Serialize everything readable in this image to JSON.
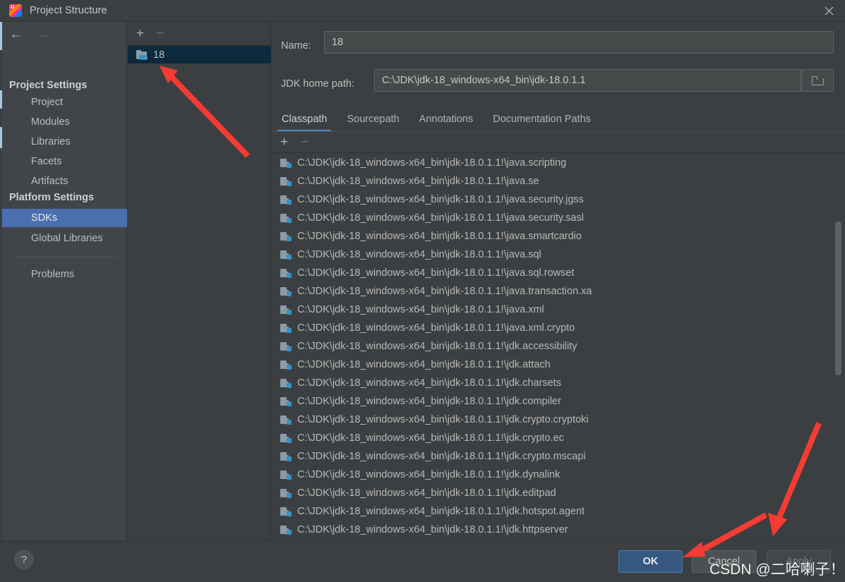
{
  "window": {
    "title": "Project Structure",
    "app_icon": "intellij-idea-icon",
    "close_icon": "close-icon"
  },
  "sidebar": {
    "back_icon": "arrow-left-icon",
    "forward_icon": "arrow-right-icon",
    "groups": [
      {
        "title": "Project Settings",
        "items": [
          "Project",
          "Modules",
          "Libraries",
          "Facets",
          "Artifacts"
        ]
      },
      {
        "title": "Platform Settings",
        "items": [
          "SDKs",
          "Global Libraries"
        ]
      }
    ],
    "selected_item": "SDKs",
    "extra_items": [
      "Problems"
    ]
  },
  "sdk_panel": {
    "add_label": "+",
    "remove_label": "−",
    "items": [
      {
        "label": "18",
        "icon": "folder-java-icon",
        "selected": true
      }
    ]
  },
  "detail": {
    "name_label": "Name:",
    "name_value": "18",
    "jdk_path_label": "JDK home path:",
    "jdk_path_value": "C:\\JDK\\jdk-18_windows-x64_bin\\jdk-18.0.1.1",
    "browse_icon": "folder-open-icon",
    "tabs": [
      {
        "label": "Classpath",
        "active": true
      },
      {
        "label": "Sourcepath",
        "active": false
      },
      {
        "label": "Annotations",
        "active": false
      },
      {
        "label": "Documentation Paths",
        "active": false
      }
    ],
    "classpath_toolbar": {
      "add_label": "+",
      "remove_label": "−",
      "remove_disabled": true
    },
    "classpath_entries": [
      "C:\\JDK\\jdk-18_windows-x64_bin\\jdk-18.0.1.1!\\java.scripting",
      "C:\\JDK\\jdk-18_windows-x64_bin\\jdk-18.0.1.1!\\java.se",
      "C:\\JDK\\jdk-18_windows-x64_bin\\jdk-18.0.1.1!\\java.security.jgss",
      "C:\\JDK\\jdk-18_windows-x64_bin\\jdk-18.0.1.1!\\java.security.sasl",
      "C:\\JDK\\jdk-18_windows-x64_bin\\jdk-18.0.1.1!\\java.smartcardio",
      "C:\\JDK\\jdk-18_windows-x64_bin\\jdk-18.0.1.1!\\java.sql",
      "C:\\JDK\\jdk-18_windows-x64_bin\\jdk-18.0.1.1!\\java.sql.rowset",
      "C:\\JDK\\jdk-18_windows-x64_bin\\jdk-18.0.1.1!\\java.transaction.xa",
      "C:\\JDK\\jdk-18_windows-x64_bin\\jdk-18.0.1.1!\\java.xml",
      "C:\\JDK\\jdk-18_windows-x64_bin\\jdk-18.0.1.1!\\java.xml.crypto",
      "C:\\JDK\\jdk-18_windows-x64_bin\\jdk-18.0.1.1!\\jdk.accessibility",
      "C:\\JDK\\jdk-18_windows-x64_bin\\jdk-18.0.1.1!\\jdk.attach",
      "C:\\JDK\\jdk-18_windows-x64_bin\\jdk-18.0.1.1!\\jdk.charsets",
      "C:\\JDK\\jdk-18_windows-x64_bin\\jdk-18.0.1.1!\\jdk.compiler",
      "C:\\JDK\\jdk-18_windows-x64_bin\\jdk-18.0.1.1!\\jdk.crypto.cryptoki",
      "C:\\JDK\\jdk-18_windows-x64_bin\\jdk-18.0.1.1!\\jdk.crypto.ec",
      "C:\\JDK\\jdk-18_windows-x64_bin\\jdk-18.0.1.1!\\jdk.crypto.mscapi",
      "C:\\JDK\\jdk-18_windows-x64_bin\\jdk-18.0.1.1!\\jdk.dynalink",
      "C:\\JDK\\jdk-18_windows-x64_bin\\jdk-18.0.1.1!\\jdk.editpad",
      "C:\\JDK\\jdk-18_windows-x64_bin\\jdk-18.0.1.1!\\jdk.hotspot.agent",
      "C:\\JDK\\jdk-18_windows-x64_bin\\jdk-18.0.1.1!\\jdk.httpserver"
    ]
  },
  "footer": {
    "help_label": "?",
    "ok_label": "OK",
    "cancel_label": "Cancel",
    "apply_label": "Apply",
    "apply_disabled": true
  },
  "watermark": "CSDN @二哈喇子！",
  "colors": {
    "accent_blue": "#4b6eaf",
    "tab_underline": "#4a88c7",
    "ok_button": "#365880",
    "selection_dark": "#0d293e",
    "annotation_red": "#f53b34",
    "background": "#3c3f41",
    "sidebar_background": "#41454a"
  }
}
